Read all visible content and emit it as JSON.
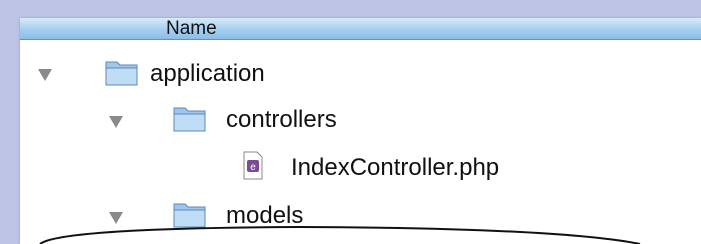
{
  "header": {
    "name_column": "Name"
  },
  "tree": [
    {
      "label": "application",
      "type": "folder",
      "expanded": true
    },
    {
      "label": "controllers",
      "type": "folder",
      "expanded": true
    },
    {
      "label": "IndexController.php",
      "type": "file"
    },
    {
      "label": "models",
      "type": "folder",
      "expanded": true
    }
  ],
  "colors": {
    "background": "#bec4e6",
    "header": "#a9d0f0",
    "folder": "#8fc0ea"
  }
}
